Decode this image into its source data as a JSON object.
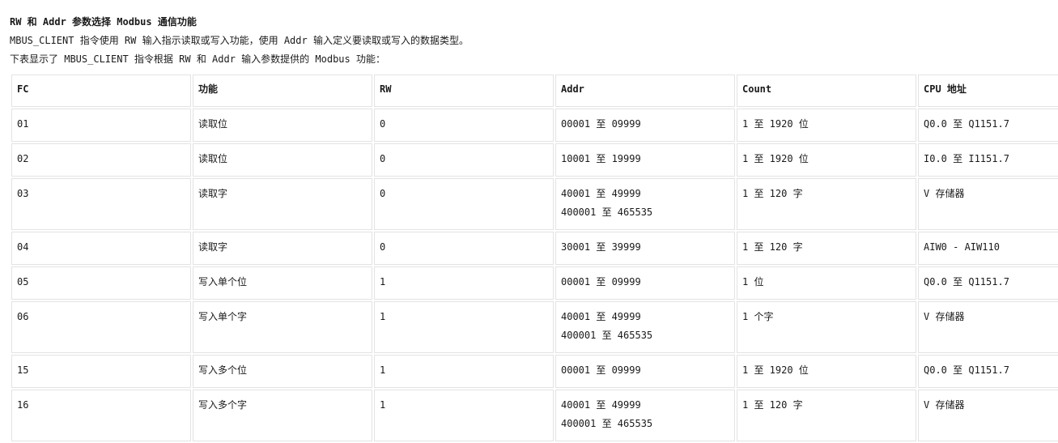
{
  "doc": {
    "heading": "RW 和 Addr 参数选择 Modbus 通信功能",
    "para1": "MBUS_CLIENT 指令使用 RW 输入指示读取或写入功能，使用 Addr 输入定义要读取或写入的数据类型。",
    "para2": "下表显示了 MBUS_CLIENT 指令根据 RW 和 Addr 输入参数提供的 Modbus 功能："
  },
  "table": {
    "headers": [
      "FC",
      "功能",
      "RW",
      "Addr",
      "Count",
      "CPU 地址"
    ],
    "rows": [
      {
        "fc": "01",
        "func": "读取位",
        "rw": "0",
        "addr": [
          "00001 至 09999"
        ],
        "count": "1 至 1920 位",
        "cpu": "Q0.0 至 Q1151.7"
      },
      {
        "fc": "02",
        "func": "读取位",
        "rw": "0",
        "addr": [
          "10001 至 19999"
        ],
        "count": "1 至 1920 位",
        "cpu": "I0.0 至 I1151.7"
      },
      {
        "fc": "03",
        "func": "读取字",
        "rw": "0",
        "addr": [
          "40001 至 49999",
          "400001 至 465535"
        ],
        "count": "1 至 120 字",
        "cpu": "V 存储器"
      },
      {
        "fc": "04",
        "func": "读取字",
        "rw": "0",
        "addr": [
          "30001 至 39999"
        ],
        "count": "1 至 120 字",
        "cpu": "AIW0 - AIW110"
      },
      {
        "fc": "05",
        "func": "写入单个位",
        "rw": "1",
        "addr": [
          "00001 至 09999"
        ],
        "count": "1 位",
        "cpu": "Q0.0 至 Q1151.7"
      },
      {
        "fc": "06",
        "func": "写入单个字",
        "rw": "1",
        "addr": [
          "40001 至 49999",
          "400001 至 465535"
        ],
        "count": "1 个字",
        "cpu": "V 存储器"
      },
      {
        "fc": "15",
        "func": "写入多个位",
        "rw": "1",
        "addr": [
          "00001 至 09999"
        ],
        "count": "1 至 1920 位",
        "cpu": "Q0.0 至 Q1151.7"
      },
      {
        "fc": "16",
        "func": "写入多个字",
        "rw": "1",
        "addr": [
          "40001 至 49999",
          "400001 至 465535"
        ],
        "count": "1 至 120 字",
        "cpu": "V 存储器"
      }
    ]
  }
}
